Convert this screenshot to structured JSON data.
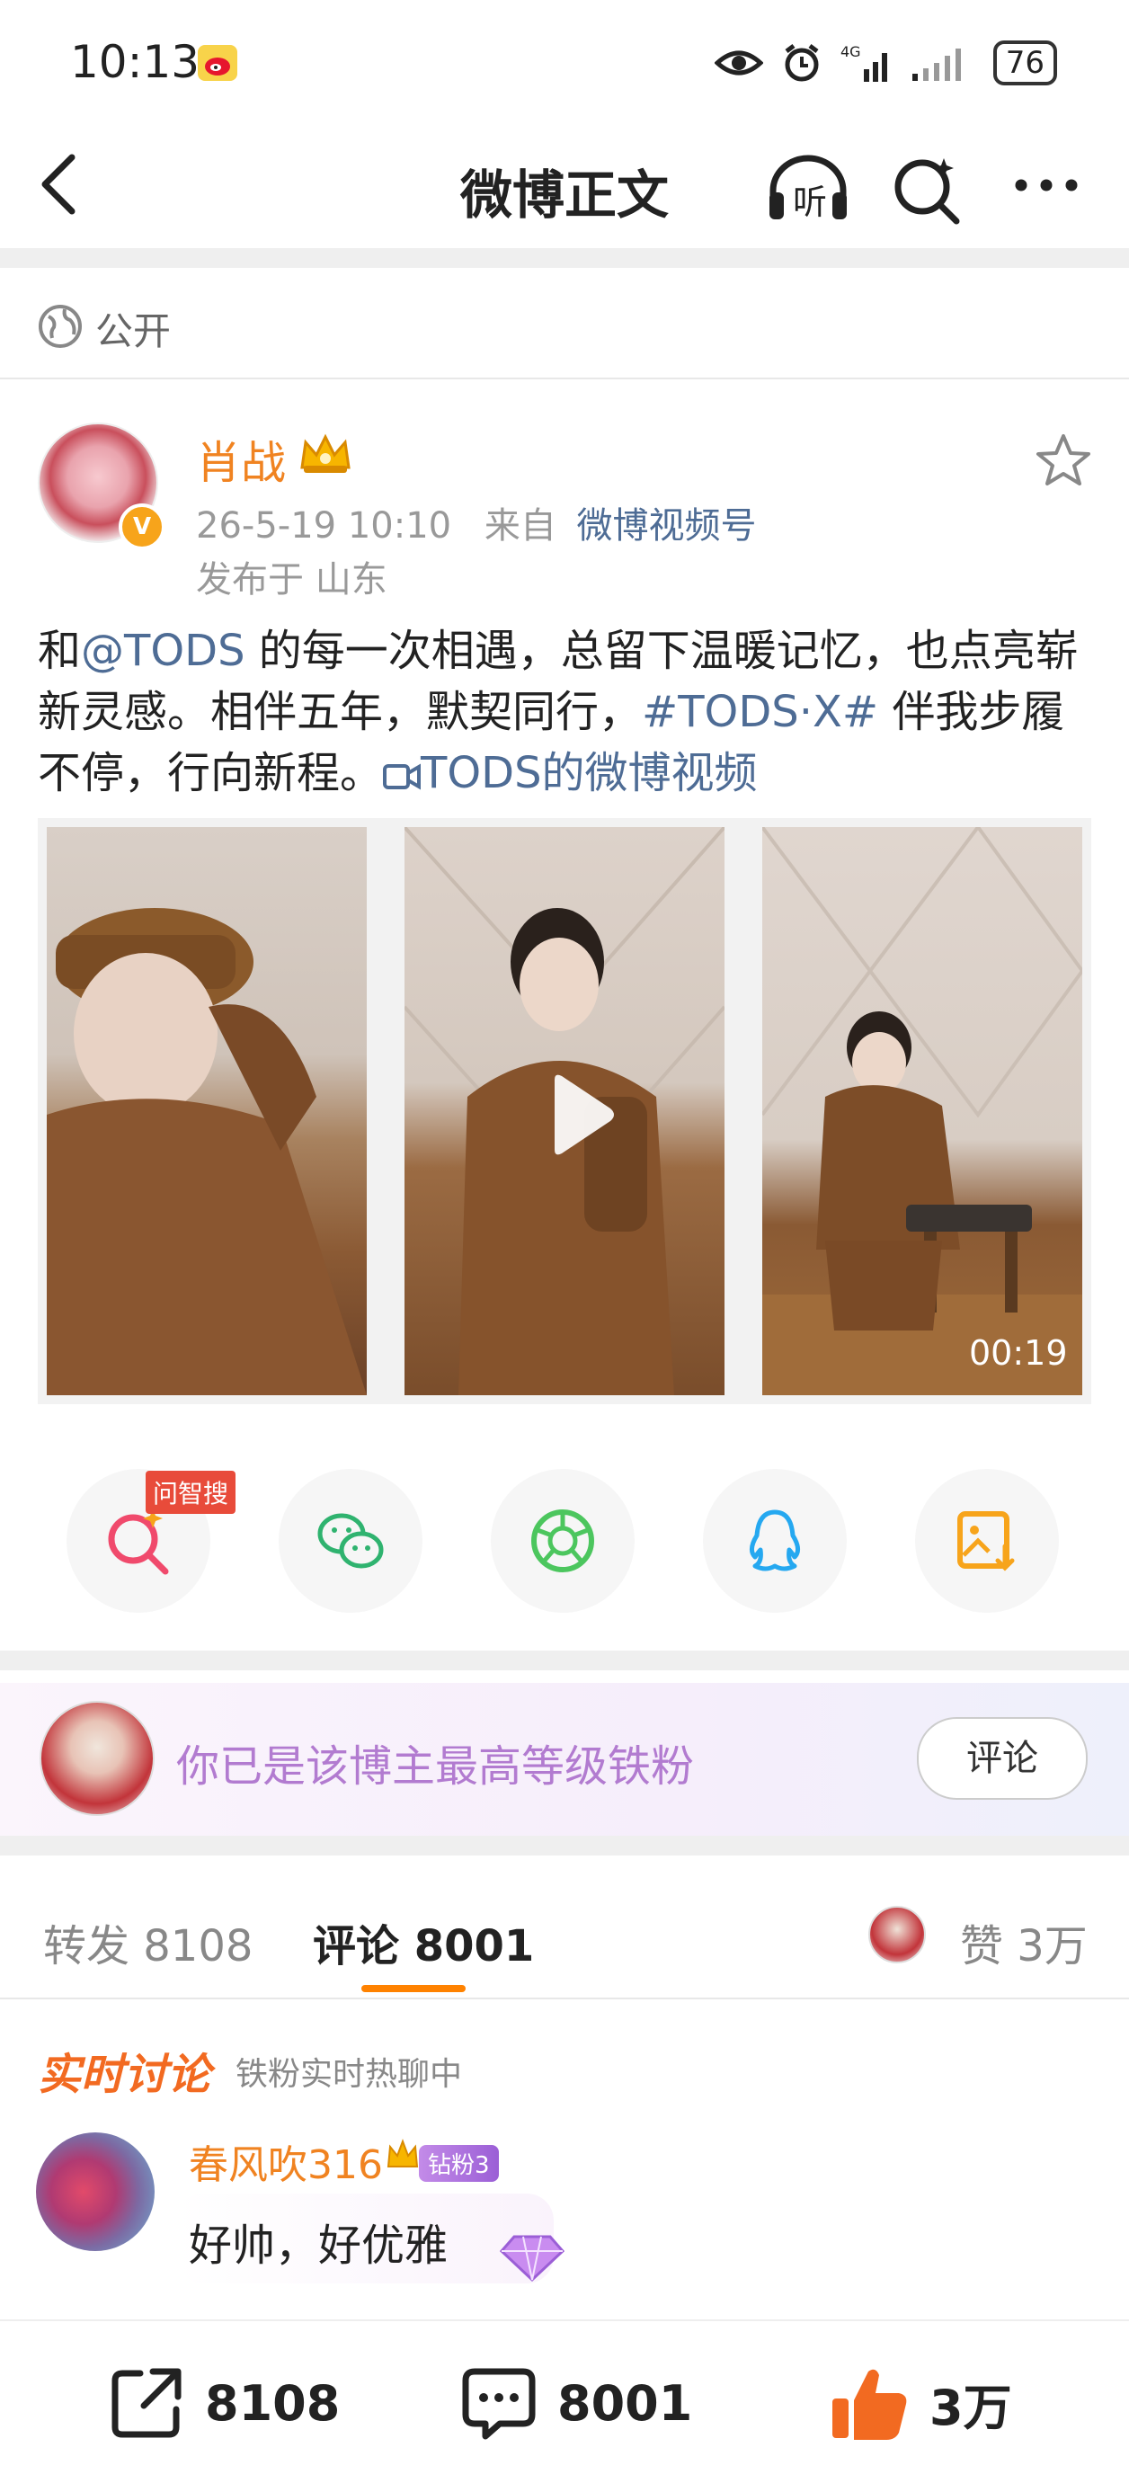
{
  "status_bar": {
    "time": "10:13",
    "battery": "76",
    "icons": [
      "weibo-mini-icon",
      "eye-icon",
      "alarm-icon",
      "signal-4g-icon",
      "signal-icon"
    ]
  },
  "nav": {
    "title": "微博正文",
    "listen_label": "听"
  },
  "visibility": {
    "label": "公开"
  },
  "author": {
    "name": "肖战",
    "verified": "V",
    "time": "26-5-19 10:10",
    "source_prefix": "来自",
    "source": "微博视频号",
    "location": "发布于 山东"
  },
  "post": {
    "text_1": "和",
    "mention": "@TODS",
    "text_2": " 的每一次相遇，总留下温暖记忆，也点亮崭新灵感。相伴五年，默契同行，",
    "hashtag": "#TODS·X#",
    "text_3": " 伴我步履不停，行向新程。",
    "video_link": "TODS的微博视频"
  },
  "video": {
    "duration": "00:19"
  },
  "share": {
    "ask_tag": "问智搜",
    "items": [
      "search-ask-icon",
      "wechat-icon",
      "moments-icon",
      "qq-icon",
      "save-image-icon"
    ]
  },
  "fan_banner": {
    "text": "你已是该博主最高等级铁粉",
    "button": "评论"
  },
  "tabs": {
    "repost": "转发 8108",
    "comment": "评论 8001",
    "like": "赞 3万"
  },
  "realtime": {
    "title": "实时讨论",
    "subtitle": "铁粉实时热聊中"
  },
  "comment": {
    "name": "春风吹316",
    "badge": "钻粉3",
    "text": "好帅，好优雅"
  },
  "bottom_bar": {
    "repost_count": "8108",
    "comment_count": "8001",
    "like_count": "3万"
  },
  "colors": {
    "accent": "#ff8200",
    "name_orange": "#f08321",
    "link_blue": "#4e6c95",
    "fan_purple": "#b27bd0"
  }
}
